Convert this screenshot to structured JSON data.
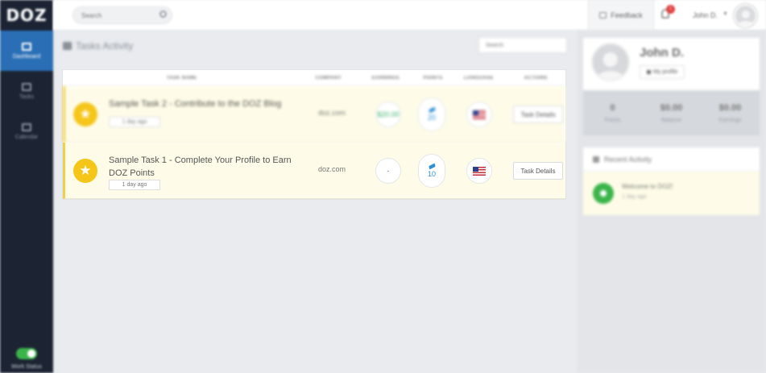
{
  "app": {
    "logo": "DOZ"
  },
  "sidebar": {
    "items": [
      {
        "label": "Dashboard",
        "active": true
      },
      {
        "label": "Tasks",
        "active": false
      },
      {
        "label": "Calendar",
        "active": false
      }
    ],
    "work_status_label": "Work Status",
    "work_status_on": true
  },
  "topbar": {
    "search_placeholder": "Search",
    "feedback_label": "Feedback",
    "notification_count": "1",
    "user_name": "John D."
  },
  "main": {
    "title": "Tasks Activity",
    "search_placeholder": "Search",
    "table": {
      "columns": [
        "TASK NAME",
        "COMPANY",
        "EARNINGS",
        "POINTS",
        "LANGUAGE",
        "ACTIONS"
      ],
      "rows": [
        {
          "title": "Sample Task 2 - Contribute to the DOZ Blog",
          "time": "1 day ago",
          "company": "doz.com",
          "earnings": "$20.00",
          "points": "20",
          "action": "Task Details"
        },
        {
          "title": "Sample Task 1 - Complete Your Profile to Earn DOZ Points",
          "time": "1 day ago",
          "company": "doz.com",
          "earnings": "-",
          "points": "10",
          "action": "Task Details"
        }
      ]
    }
  },
  "profile": {
    "name": "John D.",
    "my_profile_label": "My profile",
    "stats": [
      {
        "value": "0",
        "label": "Points"
      },
      {
        "value": "$0.00",
        "label": "Balance"
      },
      {
        "value": "$0.00",
        "label": "Earnings"
      }
    ]
  },
  "activity": {
    "title": "Recent Activity",
    "items": [
      {
        "text": "Welcome to DOZ!",
        "time": "1 day ago"
      }
    ]
  },
  "colors": {
    "sidebar_bg": "#1c2433",
    "accent_blue": "#2a6fb5",
    "star_yellow": "#f5c518",
    "earnings_green": "#3db26b",
    "points_blue": "#2d8fd5",
    "toggle_green": "#3bb54a"
  }
}
